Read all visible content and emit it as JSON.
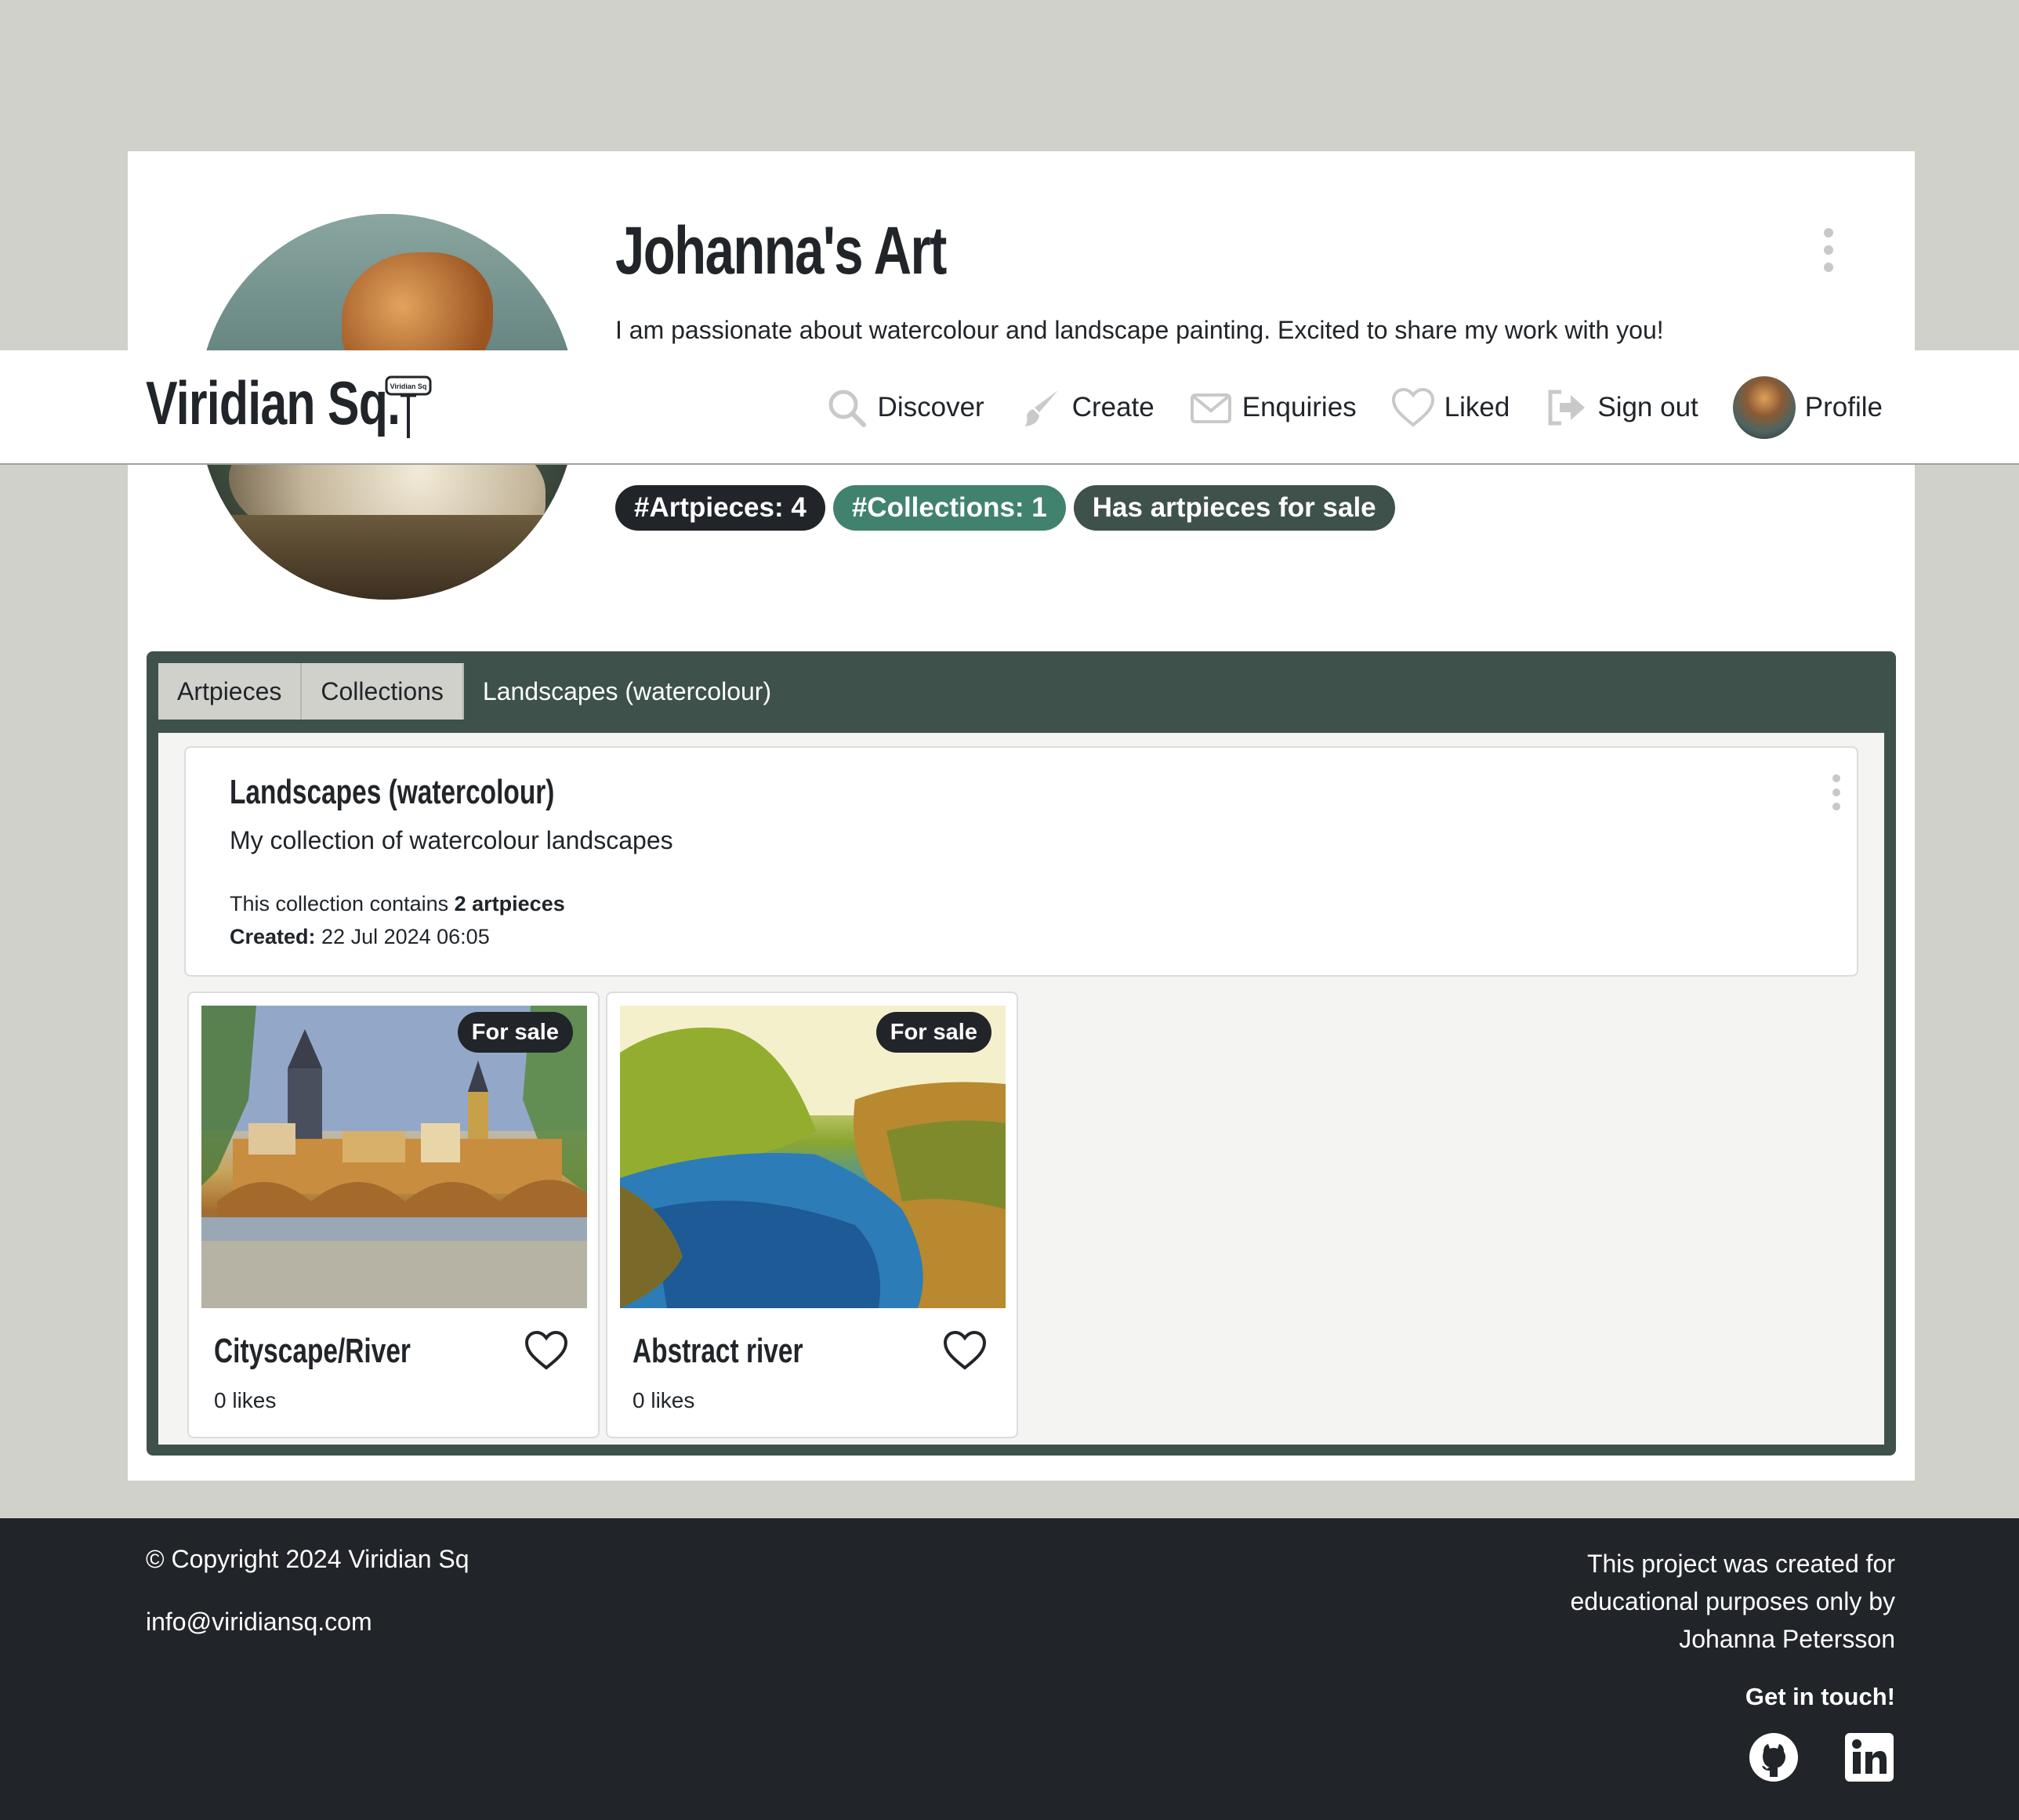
{
  "profile": {
    "title": "Johanna's Art",
    "bio": "I am passionate about watercolour and landscape painting. Excited to share my work with you!",
    "badges": {
      "artpieces": "#Artpieces: 4",
      "collections": "#Collections: 1",
      "for_sale": "Has artpieces for sale"
    }
  },
  "navbar": {
    "brand": "Viridian Sq.",
    "brand_sign": "Viridian Sq",
    "links": {
      "discover": "Discover",
      "create": "Create",
      "enquiries": "Enquiries",
      "liked": "Liked",
      "sign_out": "Sign out",
      "profile": "Profile"
    }
  },
  "tabs": {
    "artpieces": "Artpieces",
    "collections": "Collections",
    "active": "Landscapes (watercolour)"
  },
  "collection": {
    "title": "Landscapes (watercolour)",
    "description": "My collection of watercolour landscapes",
    "contains_prefix": "This collection contains ",
    "contains_count": "2 artpieces",
    "created_label": "Created:",
    "created_value": " 22 Jul 2024 06:05"
  },
  "artpieces": [
    {
      "title": "Cityscape/River",
      "likes": "0 likes",
      "badge": "For sale"
    },
    {
      "title": "Abstract river",
      "likes": "0 likes",
      "badge": "For sale"
    }
  ],
  "footer": {
    "copyright": "© Copyright 2024 Viridian Sq",
    "email": "info@viridiansq.com",
    "credit_line1": "This project was created for",
    "credit_line2": "educational purposes only by",
    "credit_line3": "Johanna Petersson",
    "get_in_touch": "Get in touch!"
  },
  "colors": {
    "page_bg": "#d0d1cb",
    "panel": "#3e514b",
    "accent_green": "#41826f",
    "dark": "#212529"
  },
  "icons": [
    "search-icon",
    "brush-icon",
    "envelope-icon",
    "heart-icon",
    "sign-out-icon",
    "github-icon",
    "linkedin-icon",
    "kebab-icon"
  ]
}
